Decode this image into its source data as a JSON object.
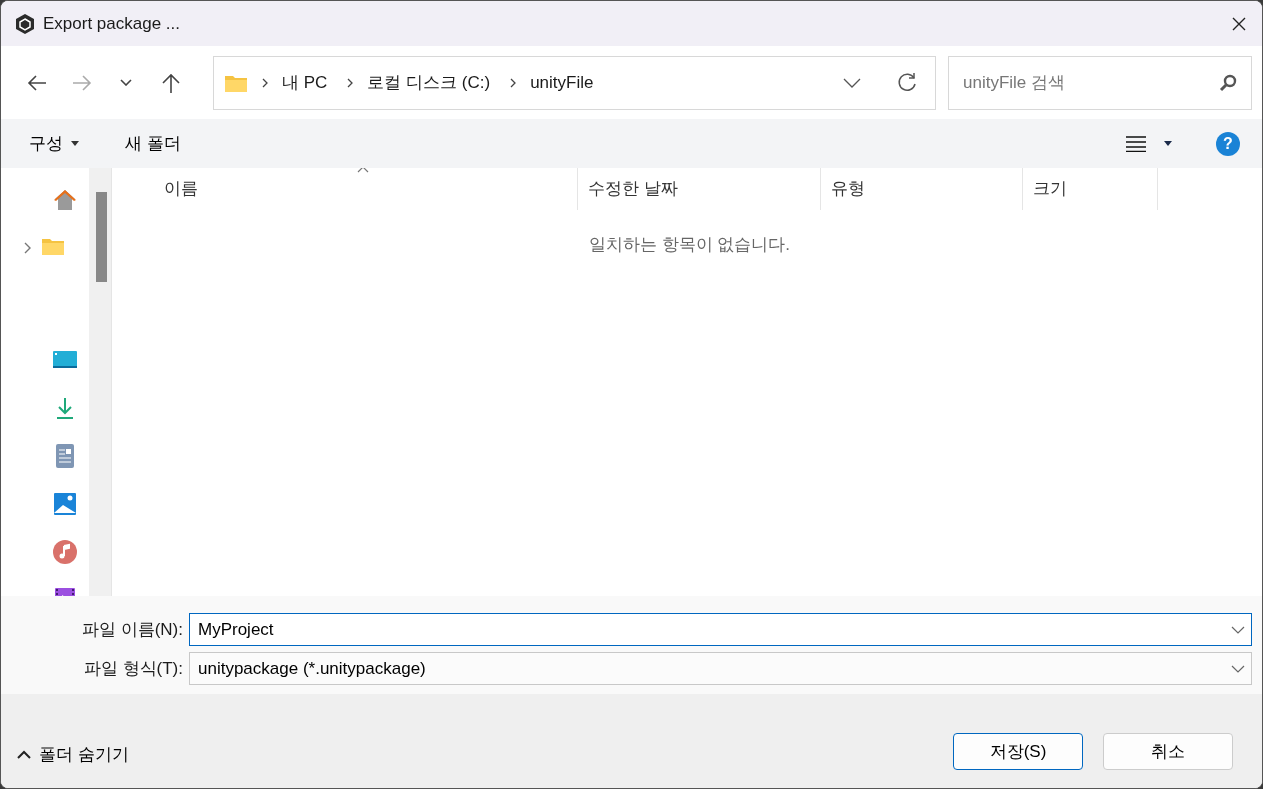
{
  "window": {
    "title": "Export package ..."
  },
  "address_bar": {
    "path": [
      "내 PC",
      "로컬 디스크 (C:)",
      "unityFile"
    ]
  },
  "search": {
    "placeholder": "unityFile 검색"
  },
  "toolbar": {
    "organize": "구성",
    "new_folder": "새 폴더",
    "help": "?"
  },
  "sidebar": {
    "folder_expanded": false
  },
  "table": {
    "columns": [
      {
        "label": "이름",
        "sorted": true
      },
      {
        "label": "수정한 날짜",
        "sorted": false
      },
      {
        "label": "유형",
        "sorted": false
      },
      {
        "label": "크기",
        "sorted": false
      }
    ],
    "empty_message": "일치하는 항목이 없습니다."
  },
  "form": {
    "file_name_label": "파일 이름(N):",
    "file_name": "MyProject",
    "file_type_label": "파일 형식(T):",
    "file_type": "unitypackage (*.unitypackage)"
  },
  "footer": {
    "hide_folders": "폴더 숨기기",
    "buttons": [
      {
        "label": "저장(S)",
        "kind": "primary"
      },
      {
        "label": "취소",
        "kind": "secondary"
      }
    ]
  }
}
